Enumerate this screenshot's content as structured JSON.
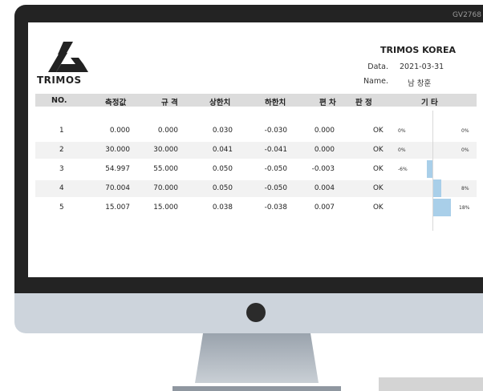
{
  "monitor": {
    "corner_label": "GV2768"
  },
  "report": {
    "logo_text": "TRIMOS",
    "company": "TRIMOS KOREA",
    "date_label": "Data.",
    "date_value": "2021-03-31",
    "name_label": "Name.",
    "name_value": "남 창훈"
  },
  "table": {
    "headers": [
      "NO.",
      "측정값",
      "규 격",
      "상한치",
      "하한치",
      "편 차",
      "판 정",
      "기 타"
    ],
    "rows": [
      {
        "no": "1",
        "measured": "0.000",
        "spec": "0.000",
        "upper": "0.030",
        "lower": "-0.030",
        "deviation": "0.000",
        "judgement": "OK",
        "pct_left": "0%",
        "pct_right": "0%",
        "ratio": 0.0
      },
      {
        "no": "2",
        "measured": "30.000",
        "spec": "30.000",
        "upper": "0.041",
        "lower": "-0.041",
        "deviation": "0.000",
        "judgement": "OK",
        "pct_left": "0%",
        "pct_right": "0%",
        "ratio": 0.0
      },
      {
        "no": "3",
        "measured": "54.997",
        "spec": "55.000",
        "upper": "0.050",
        "lower": "-0.050",
        "deviation": "-0.003",
        "judgement": "OK",
        "pct_left": "-6%",
        "pct_right": "",
        "ratio": -0.06
      },
      {
        "no": "4",
        "measured": "70.004",
        "spec": "70.000",
        "upper": "0.050",
        "lower": "-0.050",
        "deviation": "0.004",
        "judgement": "OK",
        "pct_left": "",
        "pct_right": "8%",
        "ratio": 0.08
      },
      {
        "no": "5",
        "measured": "15.007",
        "spec": "15.000",
        "upper": "0.038",
        "lower": "-0.038",
        "deviation": "0.007",
        "judgement": "OK",
        "pct_left": "",
        "pct_right": "18%",
        "ratio": 0.18
      }
    ]
  },
  "colors": {
    "bar": "#a9cfe9",
    "header_bg": "#dcdcdc",
    "bezel": "#232323",
    "chin": "#cdd4dc"
  }
}
